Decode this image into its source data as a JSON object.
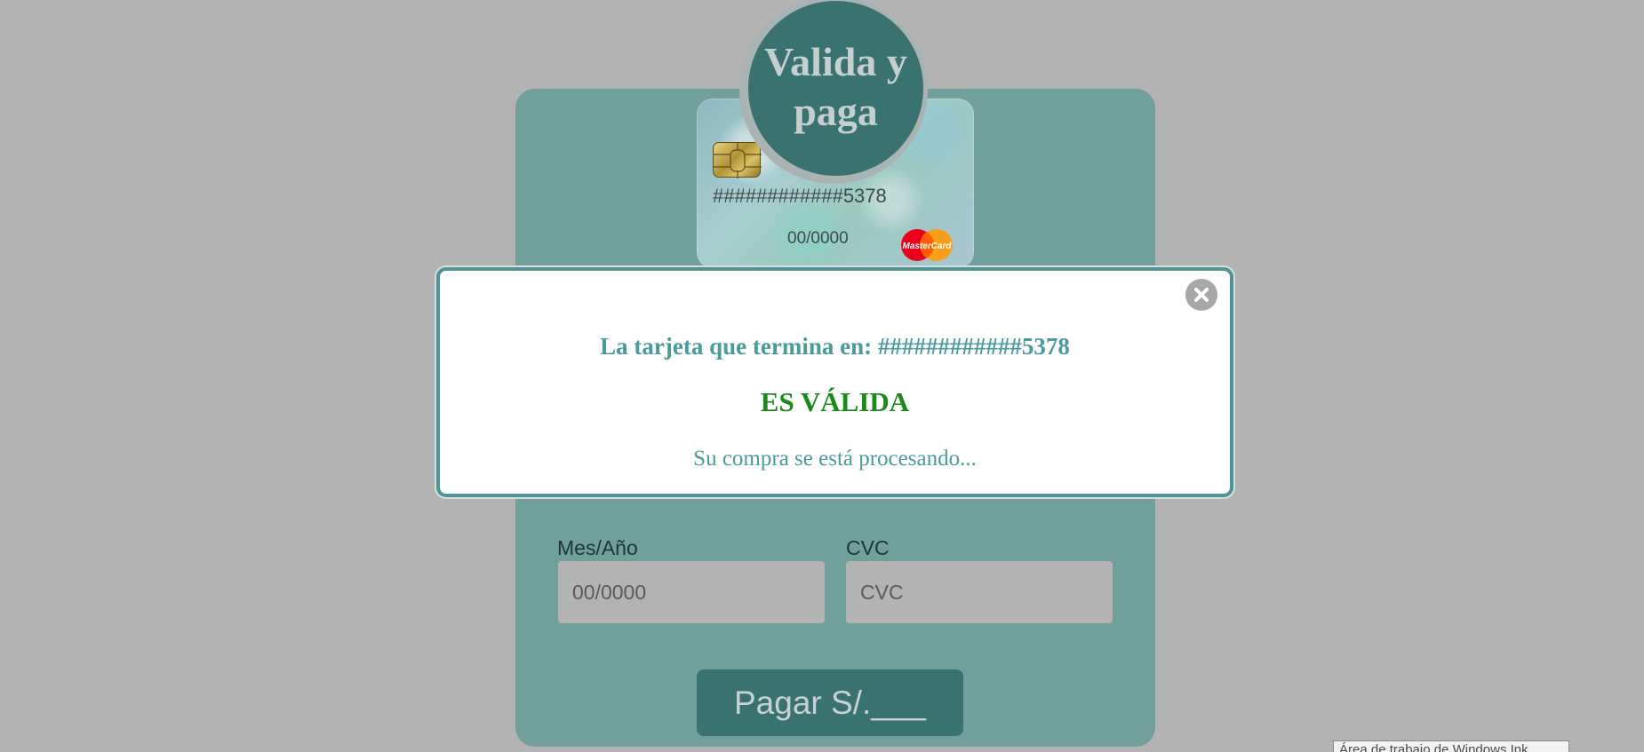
{
  "header": {
    "title": "Valida y paga"
  },
  "card": {
    "number": "############5378",
    "expiry": "00/0000",
    "brand": "MasterCard",
    "brand_colors": {
      "left": "#eb001b",
      "right": "#f79e1b"
    }
  },
  "form": {
    "expiry_label": "Mes/Año",
    "expiry_placeholder": "00/0000",
    "cvc_label": "CVC",
    "cvc_placeholder": "CVC",
    "pay_button": "Pagar S/.___"
  },
  "modal": {
    "card_line": "La tarjeta que termina en: ############5378",
    "status": "ES VÁLIDA",
    "processing": "Su compra se está procesando...",
    "close_icon": "close-icon"
  },
  "taskbar_tooltip": {
    "text": "Área de trabajo de Windows Ink"
  },
  "colors": {
    "background": "#b3b3b3",
    "panel": "#719f9c",
    "primary": "#3a7272",
    "modal_text": "#4a9b9c",
    "valid_status": "#1a8a1a"
  }
}
